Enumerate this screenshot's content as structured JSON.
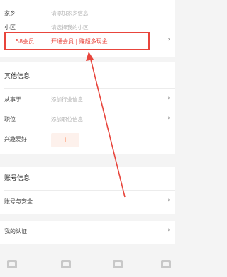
{
  "top_rows": [
    {
      "label": "家乡",
      "value": "请添加家乡信息"
    },
    {
      "label": "小区",
      "value": "请选择我的小区"
    }
  ],
  "vip": {
    "label": "58会员",
    "value": "开通会员 | 赚超多现金"
  },
  "other_info": {
    "title": "其他信息",
    "rows": [
      {
        "label": "从事于",
        "value": "添加行业信息"
      },
      {
        "label": "职位",
        "value": "添加职位信息"
      },
      {
        "label": "兴趣爱好",
        "value": "+"
      }
    ]
  },
  "account": {
    "title": "账号信息",
    "security_label": "账号与安全"
  },
  "certification": {
    "label": "我的认证"
  },
  "icons": {
    "chevron": "›",
    "bottom_tabs": [
      "contacts-icon",
      "card-icon",
      "chat-icon",
      "number-icon"
    ]
  },
  "colors": {
    "highlight": "#e8453c",
    "accent": "#ff7a45"
  }
}
